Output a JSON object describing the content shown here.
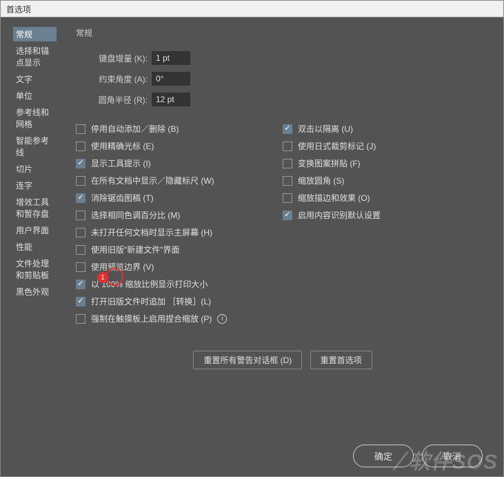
{
  "window": {
    "title": "首选项"
  },
  "sidebar": {
    "items": [
      {
        "label": "常规",
        "selected": true
      },
      {
        "label": "选择和锚点显示"
      },
      {
        "label": "文字"
      },
      {
        "label": "单位"
      },
      {
        "label": "参考线和网格"
      },
      {
        "label": "智能参考线"
      },
      {
        "label": "切片"
      },
      {
        "label": "连字"
      },
      {
        "label": "增效工具和暂存盘"
      },
      {
        "label": "用户界面"
      },
      {
        "label": "性能"
      },
      {
        "label": "文件处理和剪贴板"
      },
      {
        "label": "黑色外观"
      }
    ]
  },
  "main": {
    "title": "常规",
    "fields": {
      "keyboard_increment": {
        "label": "键盘增量 (K):",
        "value": "1 pt"
      },
      "constrain_angle": {
        "label": "约束角度 (A):",
        "value": "0°"
      },
      "corner_radius": {
        "label": "圆角半径 (R):",
        "value": "12 pt"
      }
    },
    "left_checks": [
      {
        "label": "停用自动添加／删除 (B)",
        "checked": false
      },
      {
        "label": "使用精确光标 (E)",
        "checked": false
      },
      {
        "label": "显示工具提示 (I)",
        "checked": true
      },
      {
        "label": "在所有文档中显示／隐藏标尺 (W)",
        "checked": false
      },
      {
        "label": "消除锯齿图稿 (T)",
        "checked": true
      },
      {
        "label": "选择相同色调百分比 (M)",
        "checked": false
      },
      {
        "label": "未打开任何文档时显示主屏幕 (H)",
        "checked": false
      },
      {
        "label": "使用旧版\"新建文件\"界面",
        "checked": false
      },
      {
        "label": "使用预览边界 (V)",
        "checked": false
      },
      {
        "label": "以 100% 缩放比例显示打印大小",
        "checked": true
      },
      {
        "label": "打开旧版文件时追加 ［转换］(L)",
        "checked": true
      },
      {
        "label": "强制在触摸板上启用捏合缩放 (P)",
        "checked": false,
        "info": true
      }
    ],
    "right_checks": [
      {
        "label": "双击以隔离 (U)",
        "checked": true
      },
      {
        "label": "使用日式裁剪标记 (J)",
        "checked": false
      },
      {
        "label": "变换图案拼贴 (F)",
        "checked": false
      },
      {
        "label": "缩放圆角 (S)",
        "checked": false
      },
      {
        "label": "缩放描边和效果 (O)",
        "checked": false
      },
      {
        "label": "启用内容识别默认设置",
        "checked": true
      }
    ],
    "reset_dialogs": "重置所有警告对话框 (D)",
    "reset_prefs": "重置首选项"
  },
  "footer": {
    "ok": "确定",
    "cancel": "取消"
  },
  "callout": {
    "num": "1"
  },
  "watermark": "软件SOS"
}
